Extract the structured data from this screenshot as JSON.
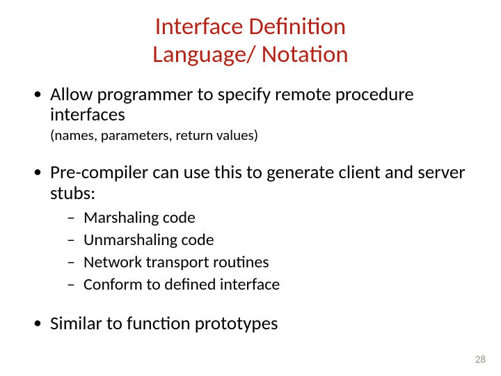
{
  "title_line1": "Interface Definition",
  "title_line2": "Language/ Notation",
  "bullets": {
    "b1_main": "Allow programmer to specify remote procedure interfaces",
    "b1_sub": "(names, parameters, return values)",
    "b2_main": "Pre-compiler can use this to generate client and server stubs:",
    "b2_sub1": "Marshaling code",
    "b2_sub2": "Unmarshaling code",
    "b2_sub3": "Network transport routines",
    "b2_sub4": "Conform to defined interface",
    "b3_main": "Similar to function prototypes"
  },
  "page_number": "28"
}
